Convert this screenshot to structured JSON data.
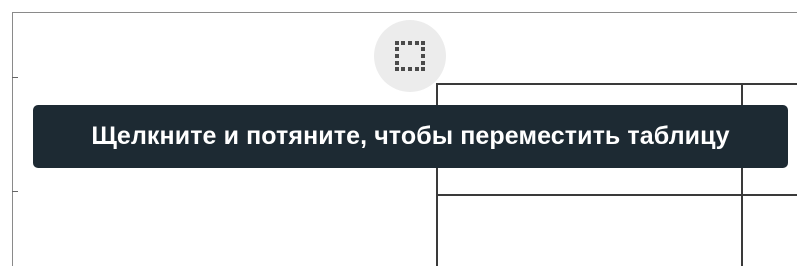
{
  "tooltip": {
    "text": "Щелкните и потяните, чтобы переместить таблицу"
  },
  "icons": {
    "move_handle": "dotted-square-move-icon"
  },
  "colors": {
    "tooltip_background": "#1d2a33",
    "tooltip_text": "#ffffff",
    "handle_background": "#ececec",
    "table_lines": "#3a3a3a"
  }
}
